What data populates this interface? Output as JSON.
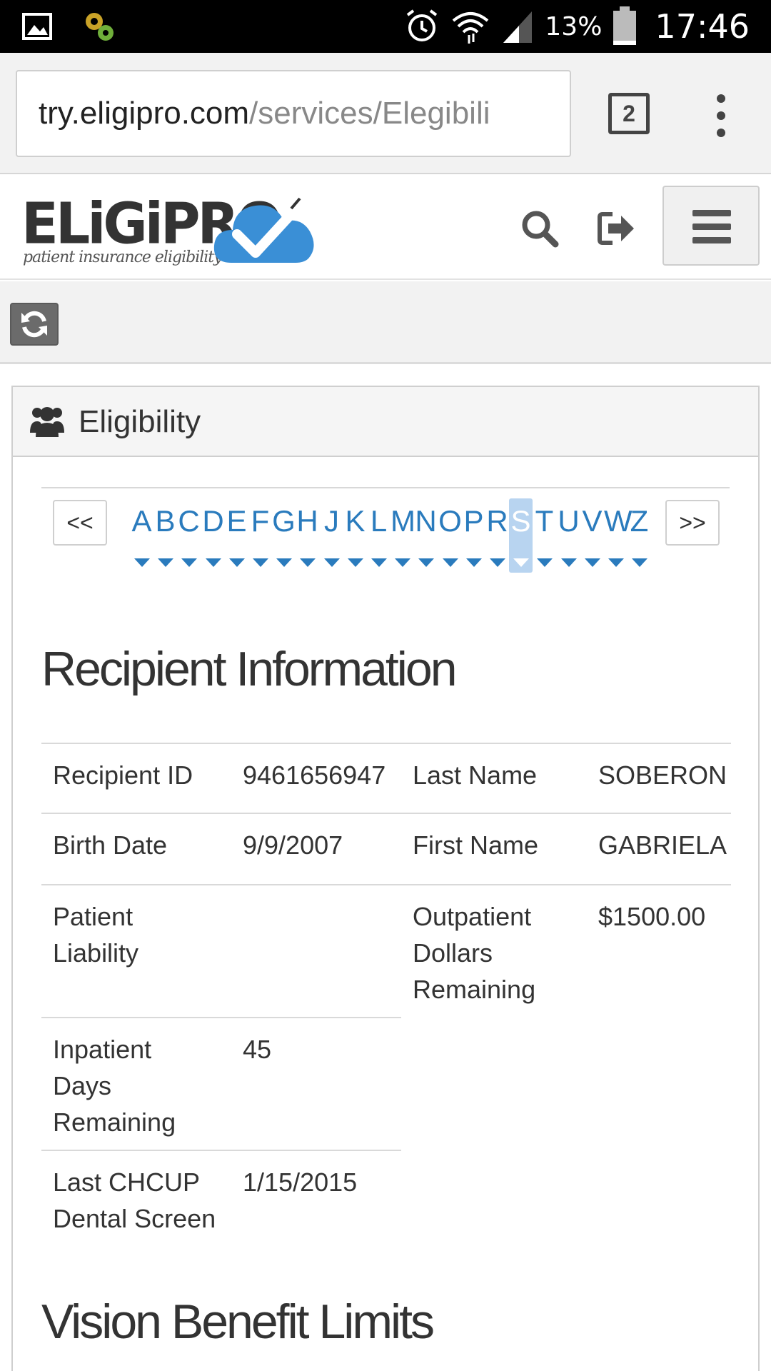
{
  "status_bar": {
    "battery": "13%",
    "time": "17:46"
  },
  "browser": {
    "url_host": "try.eligipro.com",
    "url_path": "/services/Elegibili",
    "tab_count": "2"
  },
  "header": {
    "logo_text": "ELiGiPRO",
    "logo_tagline": "patient insurance eligibility"
  },
  "panel": {
    "title": "Eligibility"
  },
  "pager": {
    "prev_label": "<<",
    "next_label": ">>",
    "letters": [
      "A",
      "B",
      "C",
      "D",
      "E",
      "F",
      "G",
      "H",
      "J",
      "K",
      "L",
      "M",
      "N",
      "O",
      "P",
      "R",
      "S",
      "T",
      "U",
      "V",
      "W",
      "Z"
    ],
    "active_letter": "S"
  },
  "recipient": {
    "heading": "Recipient Information",
    "recipient_id_label": "Recipient ID",
    "recipient_id": "9461656947",
    "last_name_label": "Last Name",
    "last_name": "SOBERON",
    "birth_date_label": "Birth Date",
    "birth_date": "9/9/2007",
    "first_name_label": "First Name",
    "first_name": "GABRIELA",
    "patient_liability_label_1": "Patient",
    "patient_liability_label_2": "Liability",
    "patient_liability": "",
    "outpatient_label_1": "Outpatient",
    "outpatient_label_2": "Dollars",
    "outpatient_label_3": "Remaining",
    "outpatient_dollars": "$1500.00",
    "inpatient_label_1": "Inpatient",
    "inpatient_label_2": "Days",
    "inpatient_label_3": "Remaining",
    "inpatient_days": "45",
    "chcup_label_1": "Last CHCUP",
    "chcup_label_2": "Dental Screen",
    "chcup_date": "1/15/2015"
  },
  "vision": {
    "heading": "Vision Benefit Limits"
  },
  "colors": {
    "link_blue": "#2a7bbd",
    "active_letter_bg": "#b8d4f0",
    "logo_cloud": "#3a8fd6"
  }
}
